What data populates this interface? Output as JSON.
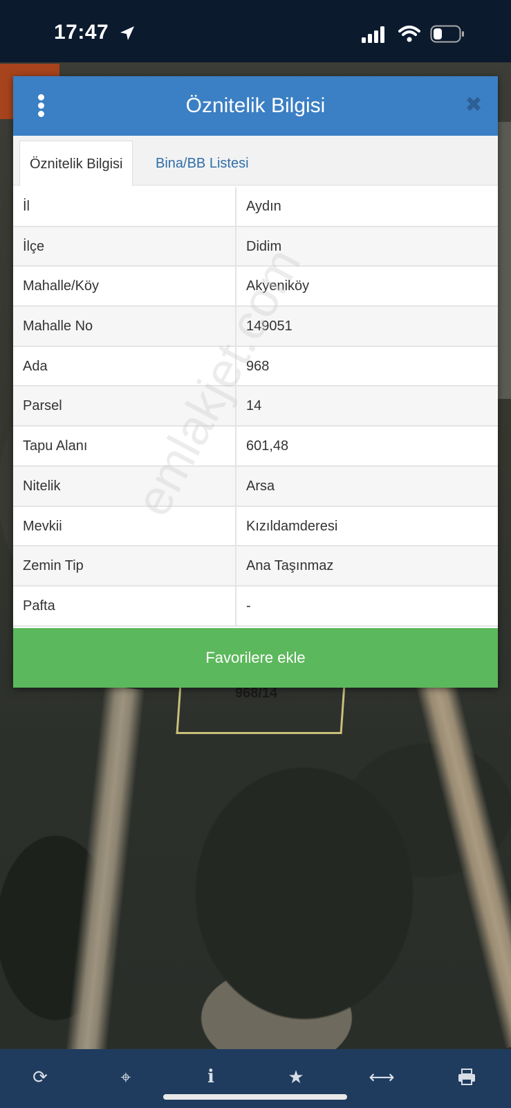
{
  "status_bar": {
    "time": "17:47"
  },
  "dialog": {
    "title": "Öznitelik Bilgisi",
    "tabs": [
      {
        "label": "Öznitelik Bilgisi",
        "active": true
      },
      {
        "label": "Bina/BB Listesi",
        "active": false
      }
    ],
    "rows": [
      {
        "key": "İl",
        "value": "Aydın"
      },
      {
        "key": "İlçe",
        "value": "Didim"
      },
      {
        "key": "Mahalle/Köy",
        "value": "Akyeniköy"
      },
      {
        "key": "Mahalle No",
        "value": "149051"
      },
      {
        "key": "Ada",
        "value": "968"
      },
      {
        "key": "Parsel",
        "value": "14"
      },
      {
        "key": "Tapu Alanı",
        "value": "601,48"
      },
      {
        "key": "Nitelik",
        "value": "Arsa"
      },
      {
        "key": "Mevkii",
        "value": "Kızıldamderesi"
      },
      {
        "key": "Zemin Tip",
        "value": "Ana Taşınmaz"
      },
      {
        "key": "Pafta",
        "value": "-"
      }
    ],
    "favorite_button": "Favorilere ekle"
  },
  "map": {
    "parcel_label": "968/14"
  },
  "watermark": "emlakjet.com",
  "colors": {
    "header_blue": "#3b7fc4",
    "button_green": "#5cb85c",
    "toolbar": "#1f3c5e",
    "status_bar": "#0c1a2e"
  },
  "toolbar_icons": [
    "refresh-icon",
    "locate-icon",
    "info-icon",
    "star-icon",
    "measure-icon",
    "print-icon"
  ]
}
